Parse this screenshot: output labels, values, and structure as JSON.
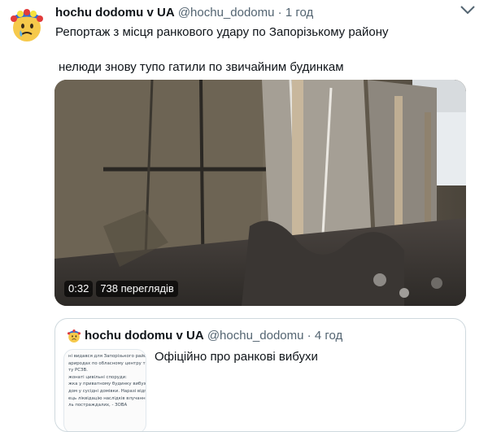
{
  "tweet": {
    "display_name": "hochu dodomu v UA",
    "handle": "@hochu_dodomu",
    "separator": "·",
    "time": "1 год",
    "text_line1": "Репортаж з місця ранкового удару по Запорізькому району",
    "text_line2": "нелюди знову тупо гатили по звичайним будинкам",
    "video": {
      "duration": "0:32",
      "views": "738 переглядів"
    }
  },
  "quoted_tweet": {
    "display_name": "hochu dodomu v UA",
    "handle": "@hochu_dodomu",
    "separator": "·",
    "time": "4 год",
    "text": "Офіційно про ранкові вибухи",
    "thumbnail_lines": [
      "ні видався для Запорізького району",
      "",
      "ариродах по обласному центру та по",
      "ту РСЗВ.",
      "",
      "жонаті цивільні споруди:",
      "жка у приватному будинку вибуховою",
      "дом у сусідні домівки. Наразі відповідні служ",
      "ець ліквідацію наслідків влучання ві",
      "",
      "ль постраждалих, - ЗОВА"
    ]
  },
  "icons": {
    "avatar": "emoji-face-with-flower-crown",
    "more": "more-options-caret-icon"
  },
  "colors": {
    "secondary_text": "#536471",
    "border": "#cfd9de"
  }
}
